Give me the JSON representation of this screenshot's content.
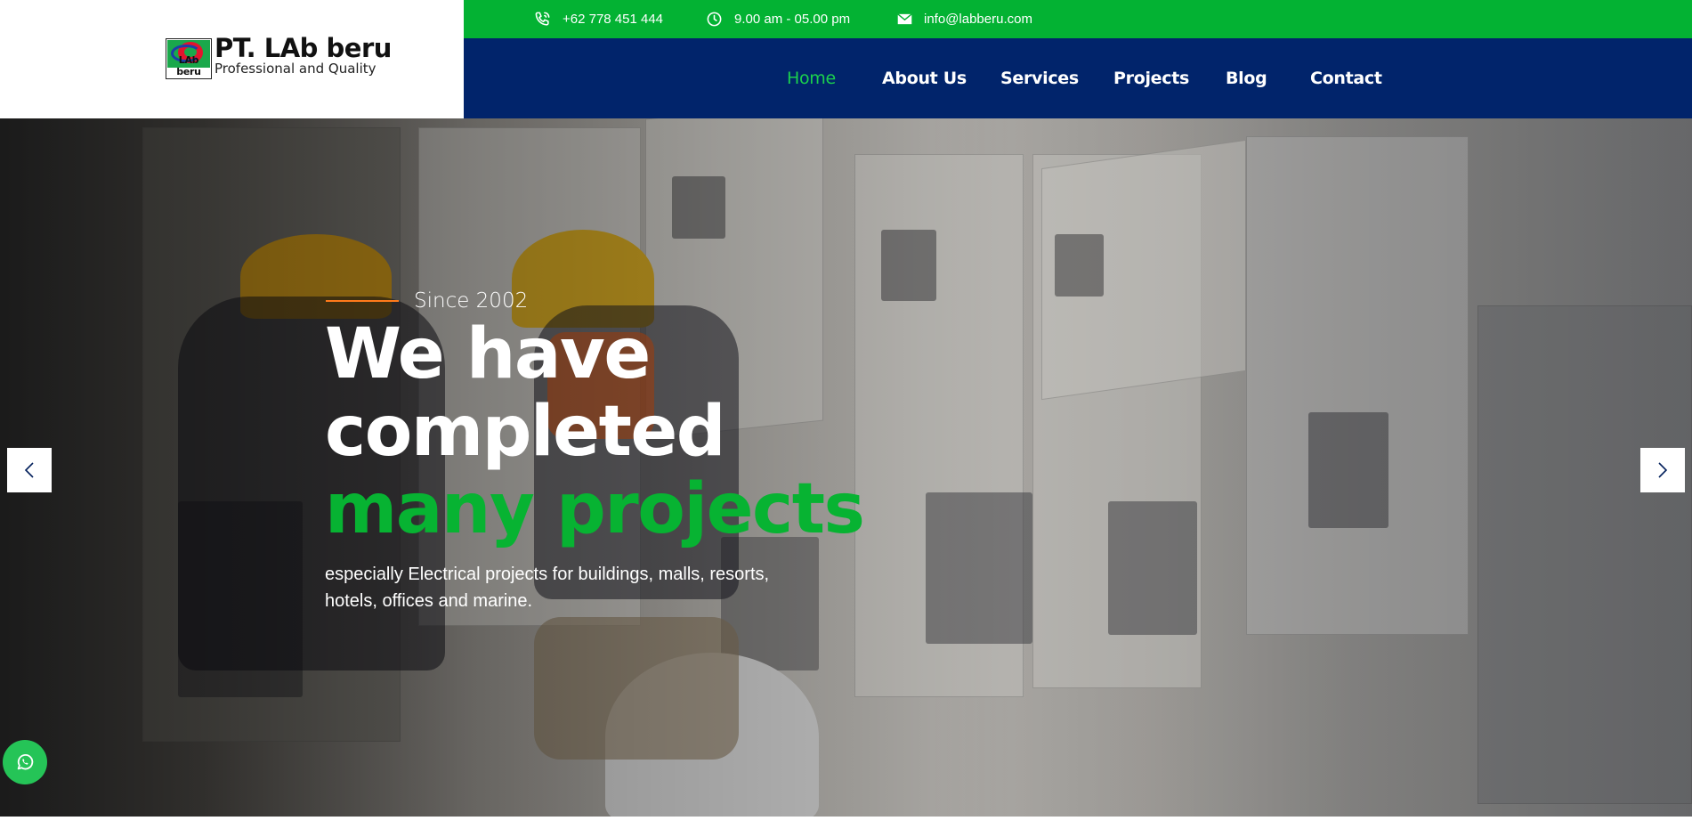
{
  "brand": {
    "name": "PT. LAb beru",
    "tagline": "Professional and Quality",
    "mark_text": "LAb beru"
  },
  "topbar": {
    "phone": "+62 778 451 444",
    "hours": "9.00 am - 05.00 pm",
    "email": "info@labberu.com"
  },
  "nav": {
    "items": [
      {
        "label": "Home",
        "active": true
      },
      {
        "label": "About Us",
        "active": false
      },
      {
        "label": "Services",
        "active": false
      },
      {
        "label": "Projects",
        "active": false
      },
      {
        "label": "Blog",
        "active": false
      },
      {
        "label": "Contact",
        "active": false
      }
    ]
  },
  "hero": {
    "kicker": "Since 2002",
    "headline_line1": "We have",
    "headline_line2": "completed",
    "headline_highlight": "many projects",
    "description": "especially Electrical projects for buildings, malls, resorts, hotels, offices and marine."
  },
  "colors": {
    "topbar_green": "#03b233",
    "nav_blue": "#01246b",
    "accent_green": "#07b332",
    "active_nav": "#1bd04d",
    "whatsapp": "#25c457",
    "kicker_line": "#ff7a1a"
  },
  "icons": {
    "phone": "phone-icon",
    "hours": "clock-icon",
    "email": "envelope-icon",
    "prev": "chevron-left-icon",
    "next": "chevron-right-icon",
    "chat": "whatsapp-icon"
  }
}
